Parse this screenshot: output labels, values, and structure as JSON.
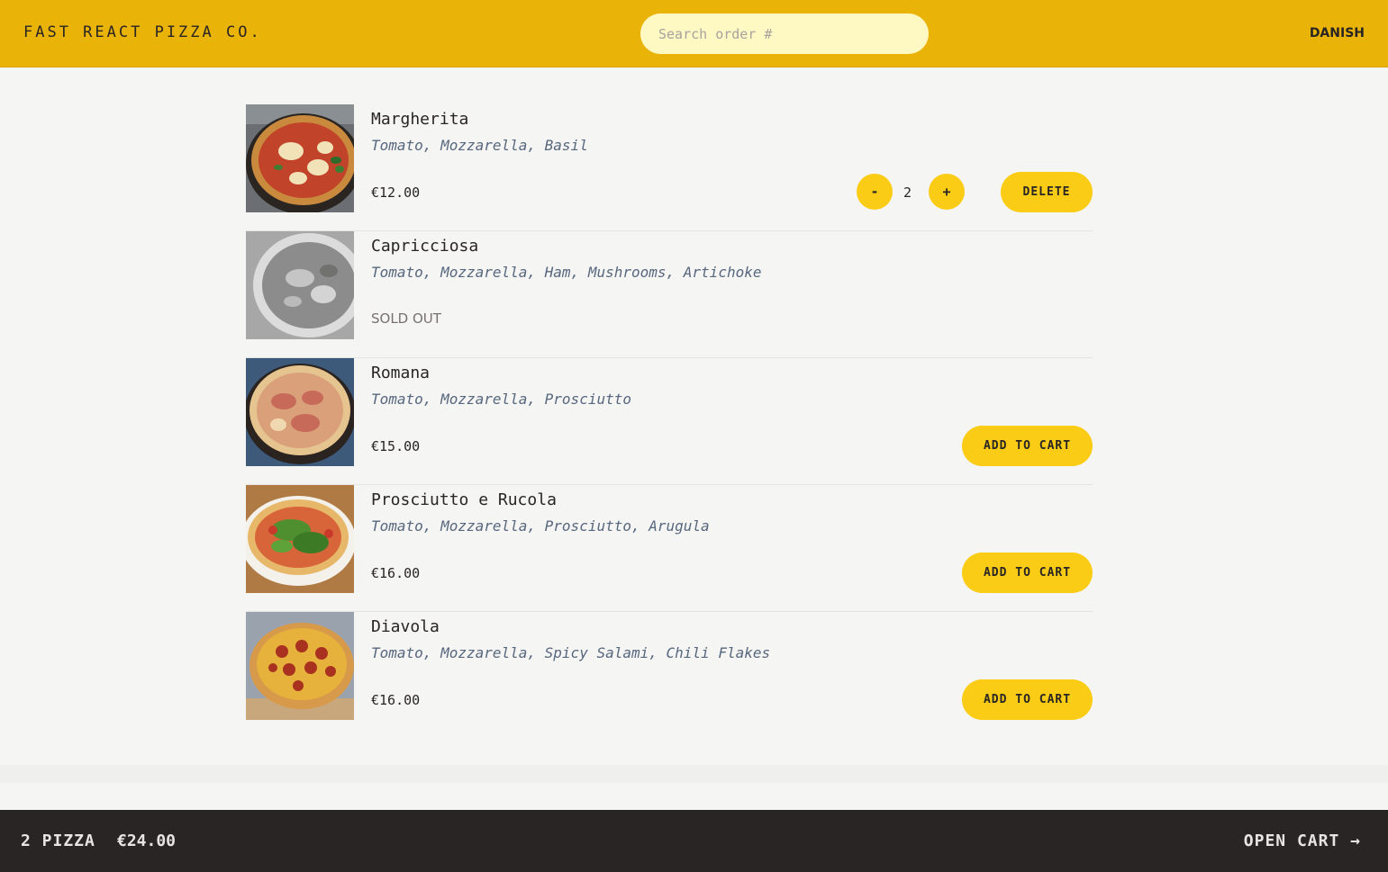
{
  "header": {
    "logo": "FAST REACT PIZZA CO.",
    "search_placeholder": "Search order #",
    "username": "DANISH"
  },
  "menu": [
    {
      "name": "Margherita",
      "ingredients": "Tomato, Mozzarella, Basil",
      "price": "€12.00",
      "sold_out": false,
      "in_cart": true,
      "quantity": "2",
      "delete_label": "DELETE",
      "minus_label": "-",
      "plus_label": "+"
    },
    {
      "name": "Capricciosa",
      "ingredients": "Tomato, Mozzarella, Ham, Mushrooms, Artichoke",
      "price": "",
      "sold_out": true,
      "status": "SOLD OUT"
    },
    {
      "name": "Romana",
      "ingredients": "Tomato, Mozzarella, Prosciutto",
      "price": "€15.00",
      "sold_out": false,
      "button_label": "ADD TO CART"
    },
    {
      "name": "Prosciutto e Rucola",
      "ingredients": "Tomato, Mozzarella, Prosciutto, Arugula",
      "price": "€16.00",
      "sold_out": false,
      "button_label": "ADD TO CART"
    },
    {
      "name": "Diavola",
      "ingredients": "Tomato, Mozzarella, Spicy Salami, Chili Flakes",
      "price": "€16.00",
      "sold_out": false,
      "button_label": "ADD TO CART"
    }
  ],
  "cart_overview": {
    "count": "2 PIZZA",
    "total": "€24.00",
    "open_label": "OPEN CART →"
  },
  "colors": {
    "header_bg": "#eab308",
    "button_bg": "#facc15",
    "footer_bg": "#292524",
    "page_bg": "#f5f5f4"
  }
}
